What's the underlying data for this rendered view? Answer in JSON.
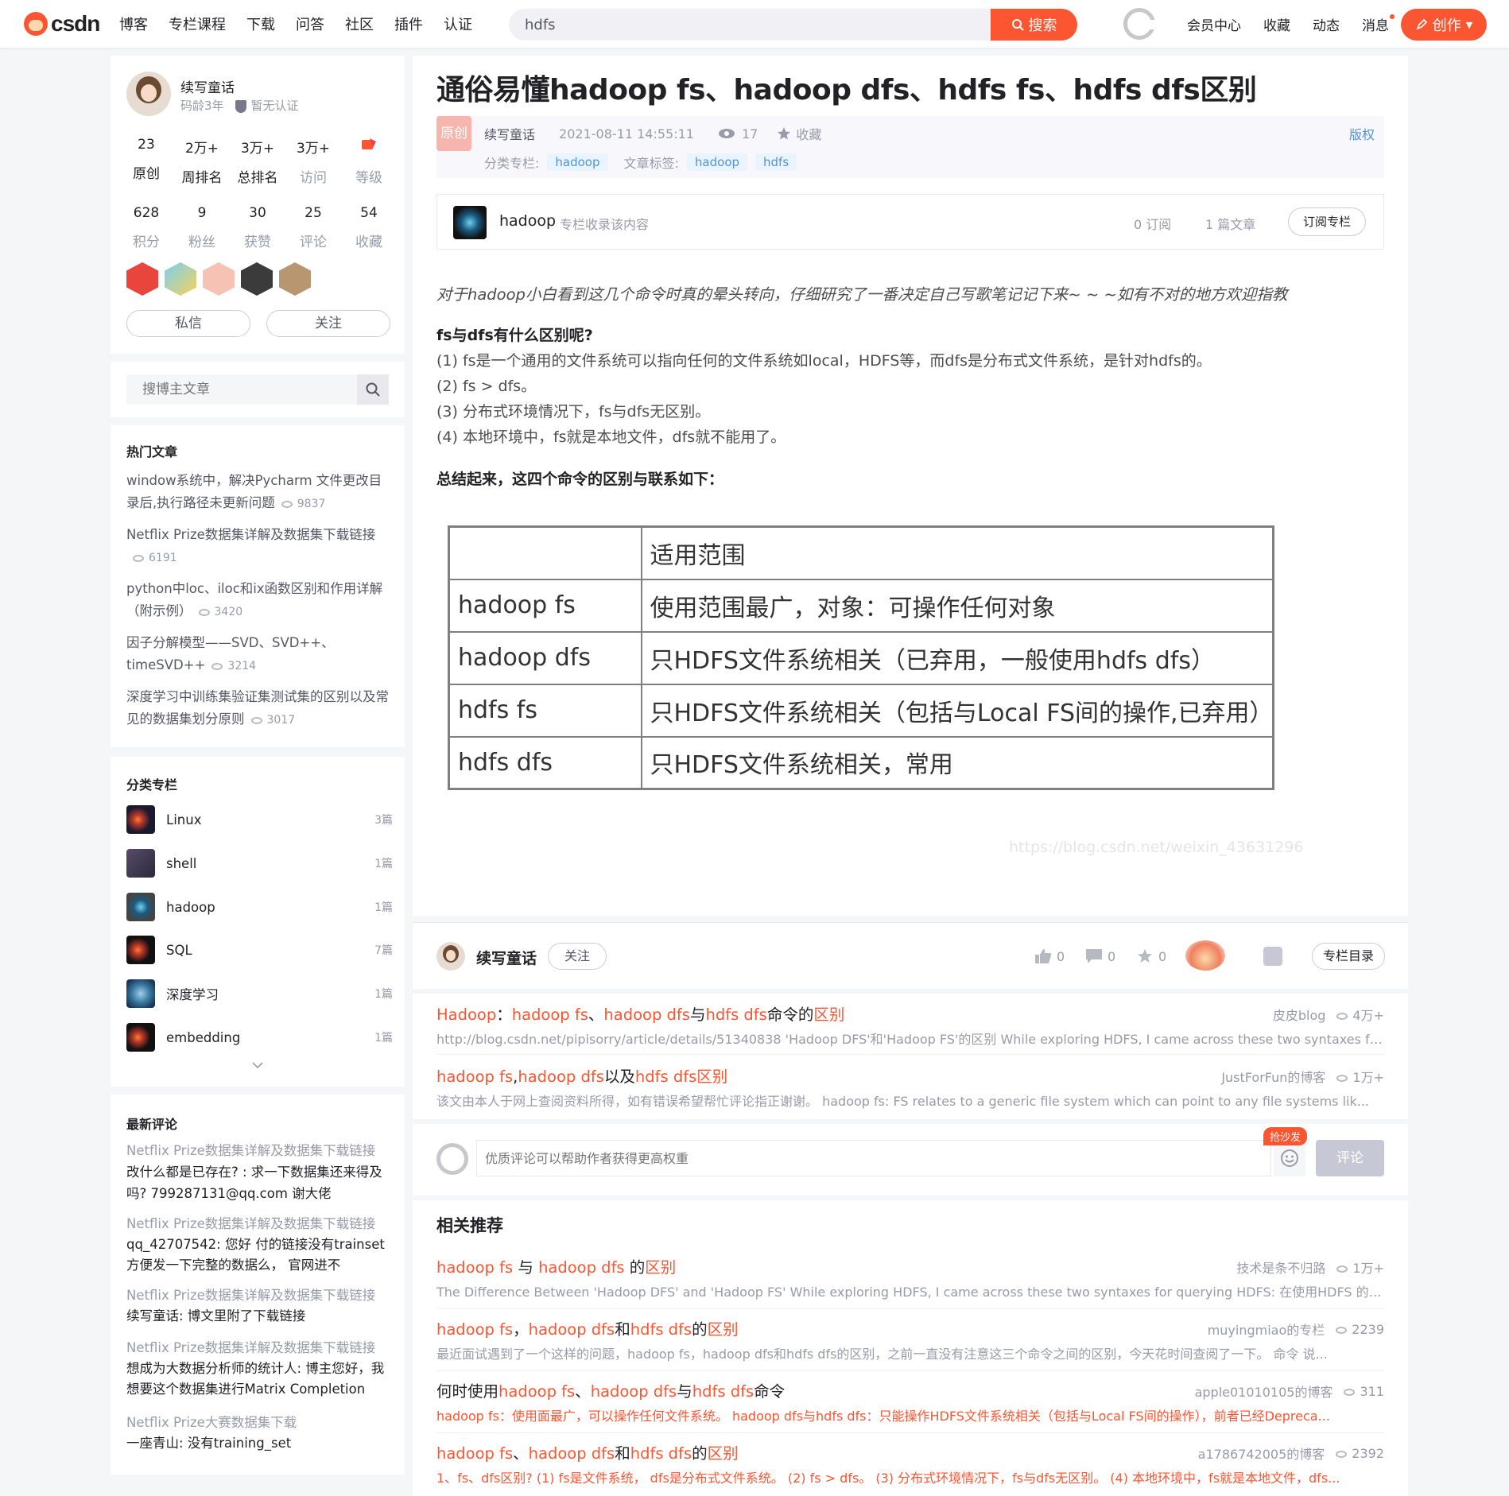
{
  "topbar": {
    "logo_text": "csdn",
    "nav": [
      "博客",
      "专栏课程",
      "下载",
      "问答",
      "社区",
      "插件",
      "认证"
    ],
    "search_value": "hdfs",
    "search_button": "搜索",
    "links": [
      "会员中心",
      "收藏",
      "动态",
      "消息"
    ],
    "create_button": "创作"
  },
  "profile": {
    "name": "续写童话",
    "code_age": "码龄3年",
    "certification": "暂无认证",
    "stats_row1": [
      {
        "value": "23",
        "label": "原创"
      },
      {
        "value": "2万+",
        "label": "周排名"
      },
      {
        "value": "3万+",
        "label": "总排名"
      },
      {
        "value": "3万+",
        "label": "访问"
      },
      {
        "value": "",
        "label": "等级"
      }
    ],
    "stats_row2": [
      {
        "value": "628",
        "label": "积分"
      },
      {
        "value": "9",
        "label": "粉丝"
      },
      {
        "value": "30",
        "label": "获赞"
      },
      {
        "value": "25",
        "label": "评论"
      },
      {
        "value": "54",
        "label": "收藏"
      }
    ],
    "message_button": "私信",
    "follow_button": "关注"
  },
  "blog_search": {
    "placeholder": "搜博主文章"
  },
  "hot_articles": {
    "title": "热门文章",
    "items": [
      {
        "title": "window系统中，解决Pycharm 文件更改目录后,执行路径未更新问题",
        "views": "9837"
      },
      {
        "title": "Netflix Prize数据集详解及数据集下载链接",
        "views": "6191"
      },
      {
        "title": "python中loc、iloc和ix函数区别和作用详解（附示例）",
        "views": "3420"
      },
      {
        "title": "因子分解模型——SVD、SVD++、timeSVD++",
        "views": "3214"
      },
      {
        "title": "深度学习中训练集验证集测试集的区别以及常见的数据集划分原则",
        "views": "3017"
      }
    ]
  },
  "columns": {
    "title": "分类专栏",
    "items": [
      {
        "name": "Linux",
        "count": "3篇"
      },
      {
        "name": "shell",
        "count": "1篇"
      },
      {
        "name": "hadoop",
        "count": "1篇"
      },
      {
        "name": "SQL",
        "count": "7篇"
      },
      {
        "name": "深度学习",
        "count": "1篇"
      },
      {
        "name": "embedding",
        "count": "1篇"
      }
    ]
  },
  "latest_comments": {
    "title": "最新评论",
    "items": [
      {
        "article": "Netflix Prize数据集详解及数据集下载链接",
        "comment": "改什么都是已存在? : 求一下数据集还来得及吗? 799287131@qq.com 谢大佬"
      },
      {
        "article": "Netflix Prize数据集详解及数据集下载链接",
        "comment": "qq_42707542: 您好 付的链接没有trainset 方便发一下完整的数据么， 官网进不"
      },
      {
        "article": "Netflix Prize数据集详解及数据集下载链接",
        "comment": "续写童话: 博文里附了下载链接"
      },
      {
        "article": "Netflix Prize数据集详解及数据集下载链接",
        "comment": "想成为大数据分析师的统计人: 博主您好，我想要这个数据集进行Matrix Completion"
      },
      {
        "article": "Netflix Prize大赛数据集下载",
        "comment": "一座青山: 没有training_set"
      }
    ]
  },
  "article": {
    "title": "通俗易懂hadoop fs、hadoop dfs、hdfs fs、hdfs dfs区别",
    "original_badge": "原创",
    "author": "续写童话",
    "date": "2021-08-11 14:55:11",
    "views": "17",
    "favorite": "收藏",
    "copyright": "版权",
    "category_label": "分类专栏:",
    "category_tags": [
      "hadoop"
    ],
    "article_tag_label": "文章标签:",
    "article_tags": [
      "hadoop",
      "hdfs"
    ],
    "column_box": {
      "name": "hadoop",
      "desc": "专栏收录该内容",
      "subscribers": "0 订阅",
      "articles": "1 篇文章",
      "subscribe_button": "订阅专栏"
    },
    "intro": "对于hadoop小白看到这几个命令时真的晕头转向，仔细研究了一番决定自己写歌笔记记下来~ ~ ~如有不对的地方欢迎指教",
    "question": "fs与dfs有什么区别呢?",
    "points": [
      "(1) fs是一个通用的文件系统可以指向任何的文件系统如local，HDFS等，而dfs是分布式文件系统，是针对hdfs的。",
      "(2) fs > dfs。",
      "(3) 分布式环境情况下，fs与dfs无区别。",
      "(4) 本地环境中，fs就是本地文件，dfs就不能用了。"
    ],
    "summary": "总结起来，这四个命令的区别与联系如下：",
    "table": {
      "header": [
        "",
        "适用范围"
      ],
      "rows": [
        [
          "hadoop fs",
          "使用范围最广，对象：可操作任何对象"
        ],
        [
          "hadoop dfs",
          "只HDFS文件系统相关（已弃用，一般使用hdfs dfs）"
        ],
        [
          "hdfs fs",
          "只HDFS文件系统相关（包括与Local FS间的操作,已弃用）"
        ],
        [
          "hdfs dfs",
          "只HDFS文件系统相关，常用"
        ]
      ]
    },
    "watermark": "https://blog.csdn.net/weixin_43631296"
  },
  "author_bar": {
    "name": "续写童话",
    "follow": "关注",
    "likes": "0",
    "comments": "0",
    "favorites": "0",
    "catalog_button": "专栏目录"
  },
  "related_top": [
    {
      "title_parts": [
        [
          "Hadoop",
          1
        ],
        [
          "：",
          0
        ],
        [
          "hadoop fs",
          1
        ],
        [
          "、",
          0
        ],
        [
          "hadoop dfs",
          1
        ],
        [
          "与",
          0
        ],
        [
          "hdfs dfs",
          1
        ],
        [
          "命令的",
          0
        ],
        [
          "区别",
          1
        ]
      ],
      "source": "皮皮blog",
      "views": "4万+",
      "desc": "http://blog.csdn.net/pipisorry/article/details/51340838 'Hadoop DFS'和'Hadoop FS'的区别 While exploring HDFS, I came across these two syntaxes for q..."
    },
    {
      "title_parts": [
        [
          "hadoop fs",
          1
        ],
        [
          ",",
          0
        ],
        [
          "hadoop dfs",
          1
        ],
        [
          "以及",
          0
        ],
        [
          "hdfs dfs",
          1
        ],
        [
          "区别",
          1
        ]
      ],
      "source": "JustForFun的博客",
      "views": "1万+",
      "desc": "该文由本人于网上查阅资料所得，如有错误希望帮忙评论指正谢谢。 hadoop fs: FS relates to a generic file system which can point to any file systems lik..."
    }
  ],
  "comment_box": {
    "placeholder": "优质评论可以帮助作者获得更高权重",
    "sofa": "抢沙发",
    "send": "评论"
  },
  "recommend": {
    "title": "相关推荐",
    "items": [
      {
        "title_parts": [
          [
            "hadoop fs",
            1
          ],
          [
            " 与 ",
            0
          ],
          [
            "hadoop dfs",
            1
          ],
          [
            " 的",
            0
          ],
          [
            "区别",
            1
          ]
        ],
        "source": "技术是条不归路",
        "views": "1万+",
        "desc": "The Difference Between 'Hadoop DFS' and 'Hadoop FS' While exploring HDFS, I came across these two syntaxes for querying HDFS: 在使用HDFS 的过..."
      },
      {
        "title_parts": [
          [
            "hadoop fs",
            1
          ],
          [
            "，",
            0
          ],
          [
            "hadoop dfs",
            1
          ],
          [
            "和",
            0
          ],
          [
            "hdfs dfs",
            1
          ],
          [
            "的",
            0
          ],
          [
            "区别",
            1
          ]
        ],
        "source": "muyingmiao的专栏",
        "views": "2239",
        "desc": "最近面试遇到了一个这样的问题，hadoop fs，hadoop dfs和hdfs dfs的区别，之前一直没有注意这三个命令之间的区别，今天花时间查阅了一下。 命令 说..."
      },
      {
        "title_parts": [
          [
            "何时使用",
            0
          ],
          [
            "hadoop fs",
            1
          ],
          [
            "、",
            0
          ],
          [
            "hadoop dfs",
            1
          ],
          [
            "与",
            0
          ],
          [
            "hdfs dfs",
            1
          ],
          [
            "命令",
            0
          ]
        ],
        "source": "apple01010105的博客",
        "views": "311",
        "desc": "hadoop fs：使用面最广，可以操作任何文件系统。 hadoop dfs与hdfs dfs：只能操作HDFS文件系统相关（包括与Local FS间的操作），前者已经Depreca..."
      },
      {
        "title_parts": [
          [
            "hadoop fs",
            1
          ],
          [
            "、",
            0
          ],
          [
            "hadoop dfs",
            1
          ],
          [
            "和",
            0
          ],
          [
            "hdfs dfs",
            1
          ],
          [
            "的",
            0
          ],
          [
            "区别",
            1
          ]
        ],
        "source": "a1786742005的博客",
        "views": "2392",
        "desc": "1、fs、dfs区别? (1) fs是文件系统， dfs是分布式文件系统。 (2) fs > dfs。 (3) 分布式环境情况下，fs与dfs无区别。 (4) 本地环境中，fs就是本地文件，dfs..."
      }
    ]
  },
  "colors": {
    "accent": "#fc5531",
    "link_blue": "#5094d5",
    "muted": "#999aaa"
  }
}
